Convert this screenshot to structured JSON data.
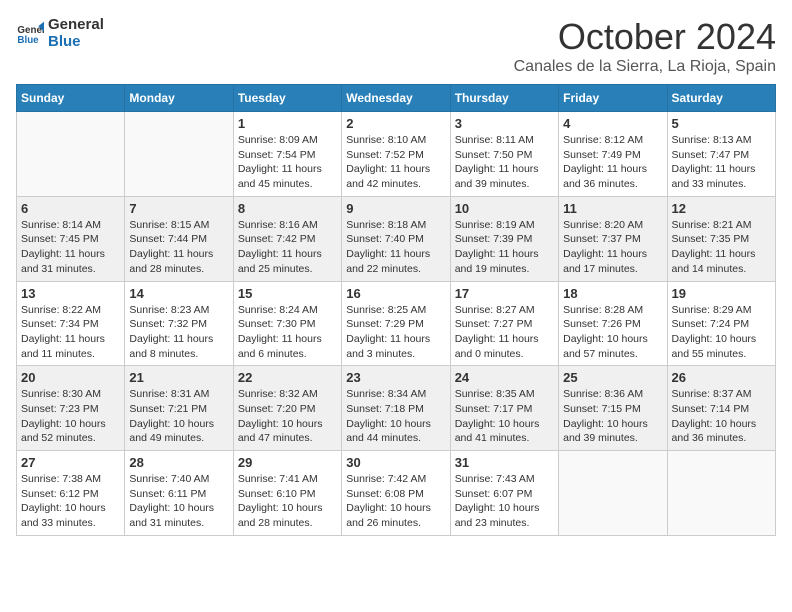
{
  "header": {
    "logo_line1": "General",
    "logo_line2": "Blue",
    "month": "October 2024",
    "location": "Canales de la Sierra, La Rioja, Spain"
  },
  "weekdays": [
    "Sunday",
    "Monday",
    "Tuesday",
    "Wednesday",
    "Thursday",
    "Friday",
    "Saturday"
  ],
  "weeks": [
    [
      {
        "day": "",
        "info": ""
      },
      {
        "day": "",
        "info": ""
      },
      {
        "day": "1",
        "info": "Sunrise: 8:09 AM\nSunset: 7:54 PM\nDaylight: 11 hours and 45 minutes."
      },
      {
        "day": "2",
        "info": "Sunrise: 8:10 AM\nSunset: 7:52 PM\nDaylight: 11 hours and 42 minutes."
      },
      {
        "day": "3",
        "info": "Sunrise: 8:11 AM\nSunset: 7:50 PM\nDaylight: 11 hours and 39 minutes."
      },
      {
        "day": "4",
        "info": "Sunrise: 8:12 AM\nSunset: 7:49 PM\nDaylight: 11 hours and 36 minutes."
      },
      {
        "day": "5",
        "info": "Sunrise: 8:13 AM\nSunset: 7:47 PM\nDaylight: 11 hours and 33 minutes."
      }
    ],
    [
      {
        "day": "6",
        "info": "Sunrise: 8:14 AM\nSunset: 7:45 PM\nDaylight: 11 hours and 31 minutes."
      },
      {
        "day": "7",
        "info": "Sunrise: 8:15 AM\nSunset: 7:44 PM\nDaylight: 11 hours and 28 minutes."
      },
      {
        "day": "8",
        "info": "Sunrise: 8:16 AM\nSunset: 7:42 PM\nDaylight: 11 hours and 25 minutes."
      },
      {
        "day": "9",
        "info": "Sunrise: 8:18 AM\nSunset: 7:40 PM\nDaylight: 11 hours and 22 minutes."
      },
      {
        "day": "10",
        "info": "Sunrise: 8:19 AM\nSunset: 7:39 PM\nDaylight: 11 hours and 19 minutes."
      },
      {
        "day": "11",
        "info": "Sunrise: 8:20 AM\nSunset: 7:37 PM\nDaylight: 11 hours and 17 minutes."
      },
      {
        "day": "12",
        "info": "Sunrise: 8:21 AM\nSunset: 7:35 PM\nDaylight: 11 hours and 14 minutes."
      }
    ],
    [
      {
        "day": "13",
        "info": "Sunrise: 8:22 AM\nSunset: 7:34 PM\nDaylight: 11 hours and 11 minutes."
      },
      {
        "day": "14",
        "info": "Sunrise: 8:23 AM\nSunset: 7:32 PM\nDaylight: 11 hours and 8 minutes."
      },
      {
        "day": "15",
        "info": "Sunrise: 8:24 AM\nSunset: 7:30 PM\nDaylight: 11 hours and 6 minutes."
      },
      {
        "day": "16",
        "info": "Sunrise: 8:25 AM\nSunset: 7:29 PM\nDaylight: 11 hours and 3 minutes."
      },
      {
        "day": "17",
        "info": "Sunrise: 8:27 AM\nSunset: 7:27 PM\nDaylight: 11 hours and 0 minutes."
      },
      {
        "day": "18",
        "info": "Sunrise: 8:28 AM\nSunset: 7:26 PM\nDaylight: 10 hours and 57 minutes."
      },
      {
        "day": "19",
        "info": "Sunrise: 8:29 AM\nSunset: 7:24 PM\nDaylight: 10 hours and 55 minutes."
      }
    ],
    [
      {
        "day": "20",
        "info": "Sunrise: 8:30 AM\nSunset: 7:23 PM\nDaylight: 10 hours and 52 minutes."
      },
      {
        "day": "21",
        "info": "Sunrise: 8:31 AM\nSunset: 7:21 PM\nDaylight: 10 hours and 49 minutes."
      },
      {
        "day": "22",
        "info": "Sunrise: 8:32 AM\nSunset: 7:20 PM\nDaylight: 10 hours and 47 minutes."
      },
      {
        "day": "23",
        "info": "Sunrise: 8:34 AM\nSunset: 7:18 PM\nDaylight: 10 hours and 44 minutes."
      },
      {
        "day": "24",
        "info": "Sunrise: 8:35 AM\nSunset: 7:17 PM\nDaylight: 10 hours and 41 minutes."
      },
      {
        "day": "25",
        "info": "Sunrise: 8:36 AM\nSunset: 7:15 PM\nDaylight: 10 hours and 39 minutes."
      },
      {
        "day": "26",
        "info": "Sunrise: 8:37 AM\nSunset: 7:14 PM\nDaylight: 10 hours and 36 minutes."
      }
    ],
    [
      {
        "day": "27",
        "info": "Sunrise: 7:38 AM\nSunset: 6:12 PM\nDaylight: 10 hours and 33 minutes."
      },
      {
        "day": "28",
        "info": "Sunrise: 7:40 AM\nSunset: 6:11 PM\nDaylight: 10 hours and 31 minutes."
      },
      {
        "day": "29",
        "info": "Sunrise: 7:41 AM\nSunset: 6:10 PM\nDaylight: 10 hours and 28 minutes."
      },
      {
        "day": "30",
        "info": "Sunrise: 7:42 AM\nSunset: 6:08 PM\nDaylight: 10 hours and 26 minutes."
      },
      {
        "day": "31",
        "info": "Sunrise: 7:43 AM\nSunset: 6:07 PM\nDaylight: 10 hours and 23 minutes."
      },
      {
        "day": "",
        "info": ""
      },
      {
        "day": "",
        "info": ""
      }
    ]
  ]
}
